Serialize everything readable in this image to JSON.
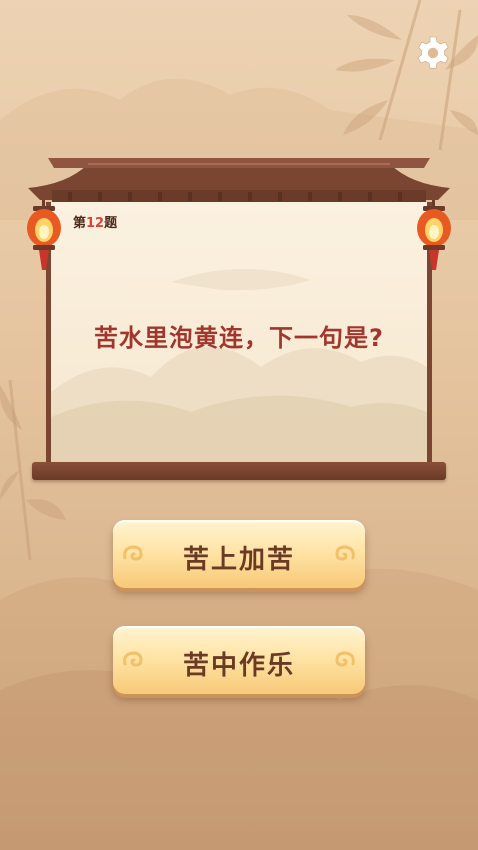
{
  "settings": {
    "icon": "gear-icon"
  },
  "question": {
    "number_prefix": "第",
    "number": "12",
    "number_suffix": "题",
    "text": "苦水里泡黄连，下一句是?"
  },
  "answers": [
    {
      "label": "苦上加苦"
    },
    {
      "label": "苦中作乐"
    }
  ],
  "colors": {
    "question_text": "#a1362c",
    "number_highlight": "#d8433a",
    "answer_text": "#6a3a25",
    "frame_wood": "#7a4632",
    "lantern": "#e85a22"
  }
}
